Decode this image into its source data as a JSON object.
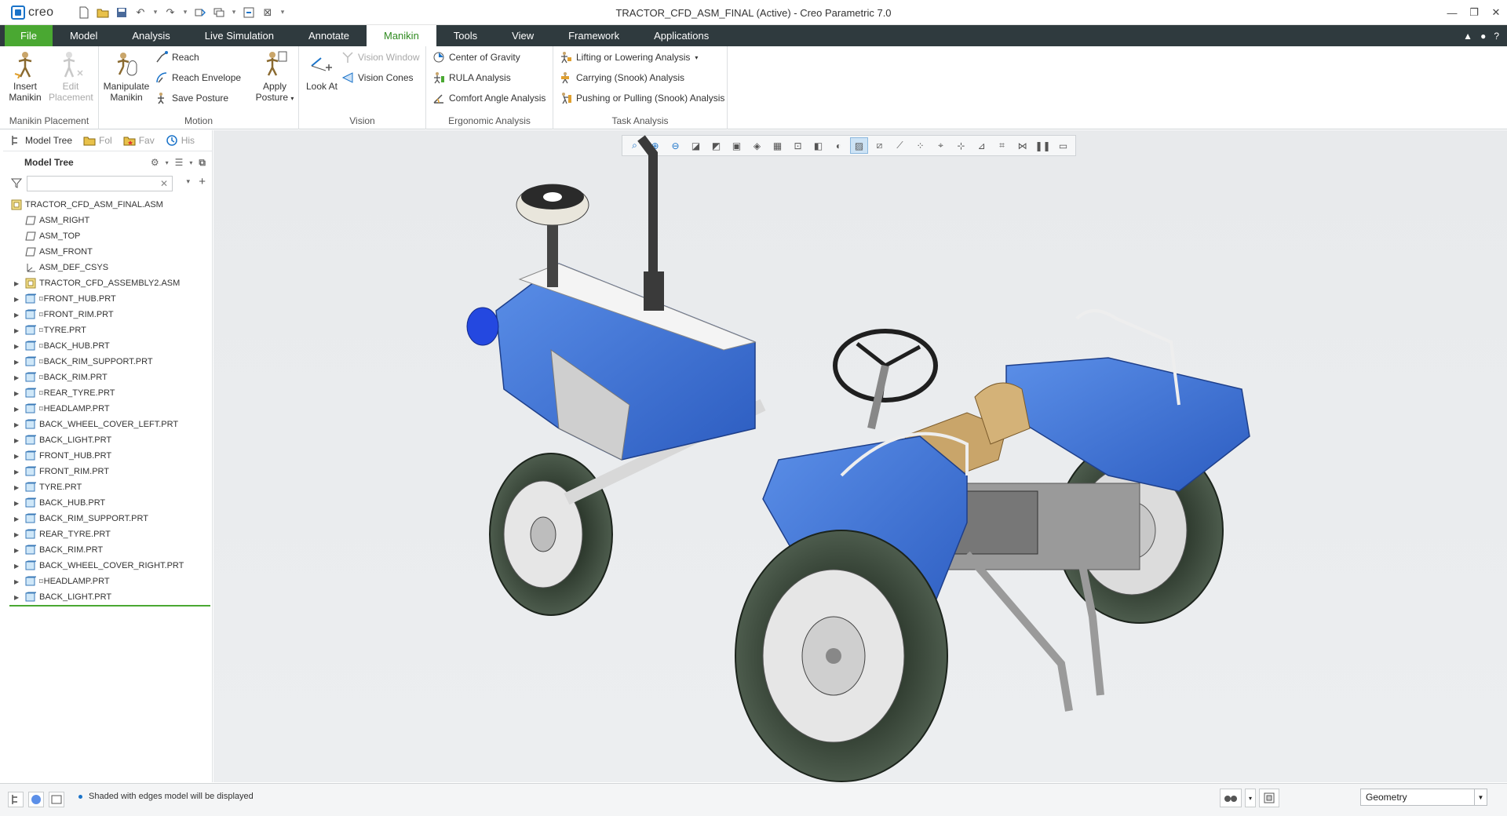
{
  "app": {
    "logo_text": "creo",
    "window_title": "TRACTOR_CFD_ASM_FINAL (Active) - Creo Parametric 7.0",
    "quick_access_icons": [
      "new-icon",
      "open-icon",
      "save-icon",
      "undo-icon",
      "redo-icon",
      "regenerate-icon",
      "windows-icon",
      "close-window-icon",
      "customize-icon"
    ]
  },
  "menu": {
    "tabs": [
      {
        "label": "File"
      },
      {
        "label": "Model"
      },
      {
        "label": "Analysis"
      },
      {
        "label": "Live Simulation"
      },
      {
        "label": "Annotate"
      },
      {
        "label": "Manikin"
      },
      {
        "label": "Tools"
      },
      {
        "label": "View"
      },
      {
        "label": "Framework"
      },
      {
        "label": "Applications"
      }
    ],
    "active_tab": "Manikin"
  },
  "ribbon": {
    "groups": {
      "manikin_placement": {
        "label": "Manikin Placement",
        "insert_line1": "Insert",
        "insert_line2": "Manikin",
        "edit_line1": "Edit",
        "edit_line2": "Placement"
      },
      "motion": {
        "label": "Motion",
        "manipulate_line1": "Manipulate",
        "manipulate_line2": "Manikin",
        "reach": "Reach",
        "reach_envelope": "Reach Envelope",
        "save_posture": "Save Posture",
        "apply_line1": "Apply",
        "apply_line2": "Posture"
      },
      "vision": {
        "label": "Vision",
        "look_at": "Look At",
        "vision_window": "Vision Window",
        "vision_cones": "Vision Cones"
      },
      "ergonomic": {
        "label": "Ergonomic Analysis",
        "center_of_gravity": "Center of Gravity",
        "rula": "RULA Analysis",
        "comfort_angle": "Comfort Angle Analysis"
      },
      "task": {
        "label": "Task Analysis",
        "lifting": "Lifting or Lowering Analysis",
        "carrying": "Carrying (Snook) Analysis",
        "pushing": "Pushing or Pulling (Snook) Analysis"
      }
    }
  },
  "navigator": {
    "tabs": [
      "Model Tree",
      "Fol",
      "Fav",
      "His"
    ],
    "tree_title": "Model Tree",
    "filter_value": "",
    "root": "TRACTOR_CFD_ASM_FINAL.ASM",
    "items": [
      {
        "label": "ASM_RIGHT",
        "icon": "datum-plane-icon",
        "expandable": false
      },
      {
        "label": "ASM_TOP",
        "icon": "datum-plane-icon",
        "expandable": false
      },
      {
        "label": "ASM_FRONT",
        "icon": "datum-plane-icon",
        "expandable": false
      },
      {
        "label": "ASM_DEF_CSYS",
        "icon": "csys-icon",
        "expandable": false
      },
      {
        "label": "TRACTOR_CFD_ASSEMBLY2.ASM",
        "icon": "assembly-icon",
        "expandable": true
      },
      {
        "label": "FRONT_HUB.PRT",
        "icon": "part-icon",
        "expandable": true,
        "flag": true
      },
      {
        "label": "FRONT_RIM.PRT",
        "icon": "part-icon",
        "expandable": true,
        "flag": true
      },
      {
        "label": "TYRE.PRT",
        "icon": "part-icon",
        "expandable": true,
        "flag": true
      },
      {
        "label": "BACK_HUB.PRT",
        "icon": "part-icon",
        "expandable": true,
        "flag": true
      },
      {
        "label": "BACK_RIM_SUPPORT.PRT",
        "icon": "part-icon",
        "expandable": true,
        "flag": true
      },
      {
        "label": "BACK_RIM.PRT",
        "icon": "part-icon",
        "expandable": true,
        "flag": true
      },
      {
        "label": "REAR_TYRE.PRT",
        "icon": "part-icon",
        "expandable": true,
        "flag": true
      },
      {
        "label": "HEADLAMP.PRT",
        "icon": "part-icon",
        "expandable": true,
        "flag": true
      },
      {
        "label": "BACK_WHEEL_COVER_LEFT.PRT",
        "icon": "part-icon",
        "expandable": true,
        "flag": false
      },
      {
        "label": "BACK_LIGHT.PRT",
        "icon": "part-icon",
        "expandable": true,
        "flag": false
      },
      {
        "label": "FRONT_HUB.PRT",
        "icon": "part-icon",
        "expandable": true,
        "flag": false
      },
      {
        "label": "FRONT_RIM.PRT",
        "icon": "part-icon",
        "expandable": true,
        "flag": false
      },
      {
        "label": "TYRE.PRT",
        "icon": "part-icon",
        "expandable": true,
        "flag": false
      },
      {
        "label": "BACK_HUB.PRT",
        "icon": "part-icon",
        "expandable": true,
        "flag": false
      },
      {
        "label": "BACK_RIM_SUPPORT.PRT",
        "icon": "part-icon",
        "expandable": true,
        "flag": false
      },
      {
        "label": "REAR_TYRE.PRT",
        "icon": "part-icon",
        "expandable": true,
        "flag": false
      },
      {
        "label": "BACK_RIM.PRT",
        "icon": "part-icon",
        "expandable": true,
        "flag": false
      },
      {
        "label": "BACK_WHEEL_COVER_RIGHT.PRT",
        "icon": "part-icon",
        "expandable": true,
        "flag": false
      },
      {
        "label": "HEADLAMP.PRT",
        "icon": "part-icon",
        "expandable": true,
        "flag": true
      },
      {
        "label": "BACK_LIGHT.PRT",
        "icon": "part-icon",
        "expandable": true,
        "flag": false
      }
    ]
  },
  "graphics": {
    "view_toolbar_icons": [
      "refit-icon",
      "zoom-in-icon",
      "zoom-out-icon",
      "repaint-icon",
      "reorient-icon",
      "saved-orientations-icon",
      "display-style-icon",
      "perspective-icon",
      "section-icon",
      "view-manager-icon",
      "appearance-icon",
      "shaded-with-edges-icon",
      "plane-display-icon",
      "axis-display-icon",
      "point-display-icon",
      "csys-display-icon",
      "spin-center-icon",
      "annotation-display-icon",
      "feature-display-icon",
      "simulation-icon",
      "pause-icon",
      "stop-icon"
    ],
    "model_colors": {
      "body": "#3a6fd8",
      "tyre": "#3b4a3a",
      "rim": "#d8d8d8",
      "seat": "#c9a56a"
    }
  },
  "status": {
    "message": "Shaded with edges model will be displayed",
    "selection_filter": "Geometry"
  },
  "colors": {
    "accent_green": "#4aa832",
    "menubar": "#2f3a3e"
  }
}
